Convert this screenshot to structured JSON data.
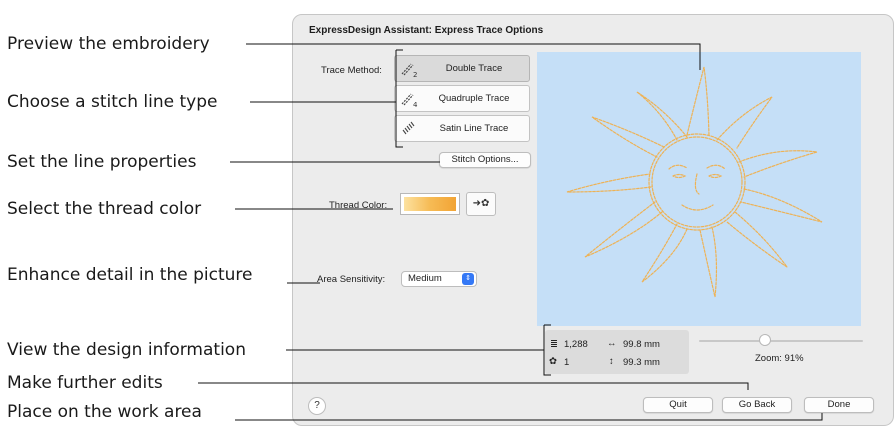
{
  "callouts": {
    "preview": "Preview the embroidery",
    "stitch_line": "Choose a stitch line type",
    "line_props": "Set the line properties",
    "thread_color": "Select the thread color",
    "detail": "Enhance detail in the picture",
    "design_info": "View the design information",
    "further_edits": "Make further edits",
    "place": "Place on the work area"
  },
  "dialog": {
    "title": "ExpressDesign Assistant: Express Trace Options",
    "trace_method_label": "Trace Method:",
    "trace_methods": [
      {
        "label": "Double Trace",
        "selected": true,
        "icon": "double-trace-icon"
      },
      {
        "label": "Quadruple Trace",
        "selected": false,
        "icon": "quadruple-trace-icon"
      },
      {
        "label": "Satin Line Trace",
        "selected": false,
        "icon": "satin-line-icon"
      }
    ],
    "stitch_options_label": "Stitch Options...",
    "thread_color_label": "Thread Color:",
    "thread_color": "#f4b042",
    "palette_button": "palette-icon",
    "area_sensitivity_label": "Area Sensitivity:",
    "area_sensitivity_value": "Medium",
    "info": {
      "stitches": "1,288",
      "colors": "1",
      "width": "99.8 mm",
      "height": "99.3 mm"
    },
    "zoom_label": "Zoom: 91%",
    "zoom_slider": 0.45,
    "help_label": "?",
    "quit_label": "Quit",
    "go_back_label": "Go Back",
    "done_label": "Done",
    "preview_bg": "#c5dff7",
    "stitch_color": "#f2b34a"
  }
}
